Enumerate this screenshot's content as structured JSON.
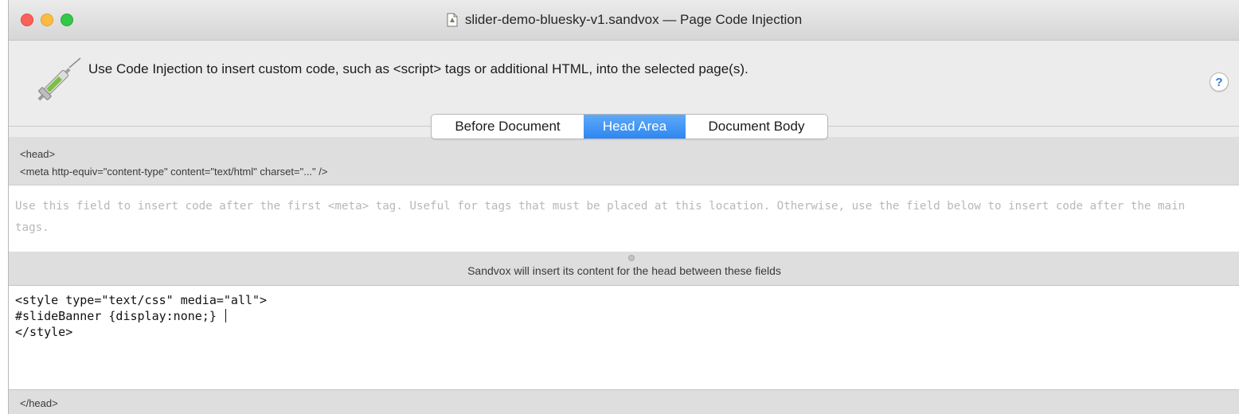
{
  "window": {
    "title": "slider-demo-bluesky-v1.sandvox — Page Code Injection",
    "document_icon": "document-icon"
  },
  "header": {
    "icon": "syringe-icon",
    "description": "Use Code Injection to insert custom code, such as <script> tags or additional HTML, into the selected page(s).",
    "help_label": "?"
  },
  "tabs": [
    {
      "label": "Before Document",
      "selected": false
    },
    {
      "label": "Head Area",
      "selected": true
    },
    {
      "label": "Document Body",
      "selected": false
    }
  ],
  "head_info": {
    "open_tag": "<head>",
    "meta_tag": "<meta http-equiv=\"content-type\" content=\"text/html\" charset=\"...\" />"
  },
  "top_field": {
    "placeholder": "Use this field to insert code after the first <meta> tag. Useful for tags that must be placed at this location. Otherwise, use the field below to insert code after the main tags."
  },
  "splitter": {
    "label": "Sandvox will insert its content for the head between these fields"
  },
  "bottom_field": {
    "lines": [
      "<style type=\"text/css\" media=\"all\">",
      "#slideBanner {display:none;} ",
      "</style>"
    ]
  },
  "footer": {
    "close_tag": "</head>"
  },
  "colors": {
    "selected_tab": "#3a8ff5",
    "help_icon": "#2b7ae0",
    "syringe_liquid": "#7bc043"
  }
}
